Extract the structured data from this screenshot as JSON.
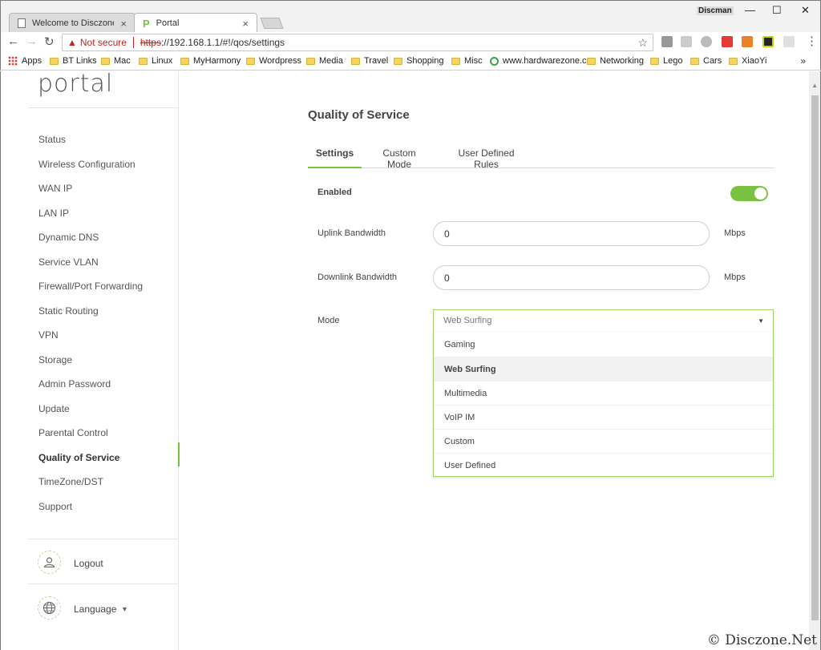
{
  "browser": {
    "profile_name": "Discman",
    "tabs": [
      {
        "label": "Welcome to Disczone! -",
        "close": "×"
      },
      {
        "label": "Portal",
        "close": "×"
      }
    ],
    "security_label": "Not secure",
    "url_protocol": "https",
    "url_rest": "://192.168.1.1/#!/qos/settings",
    "bookmarks": [
      "Apps",
      "BT Links",
      "Mac",
      "Linux",
      "MyHarmony",
      "Wordpress",
      "Media",
      "Travel",
      "Shopping",
      "Misc",
      "www.hardwarezone.c",
      "Networking",
      "Lego",
      "Cars",
      "XiaoYi"
    ],
    "more": "»"
  },
  "sidebar": {
    "logo": "portal",
    "items": [
      "Status",
      "Wireless Configuration",
      "WAN IP",
      "LAN IP",
      "Dynamic DNS",
      "Service VLAN",
      "Firewall/Port Forwarding",
      "Static Routing",
      "VPN",
      "Storage",
      "Admin Password",
      "Update",
      "Parental Control",
      "Quality of Service",
      "TimeZone/DST",
      "Support"
    ],
    "active_item": "Quality of Service",
    "logout": "Logout",
    "language": "Language"
  },
  "main": {
    "title": "Quality of Service",
    "tabs": [
      "Settings",
      "Custom Mode",
      "User Defined Rules"
    ],
    "active_tab": "Settings",
    "enabled_label": "Enabled",
    "enabled": true,
    "uplink_label": "Uplink Bandwidth",
    "uplink_value": "0",
    "downlink_label": "Downlink Bandwidth",
    "downlink_value": "0",
    "unit": "Mbps",
    "mode_label": "Mode",
    "mode_value": "Web Surfing",
    "mode_options": [
      "Gaming",
      "Web Surfing",
      "Multimedia",
      "VoIP IM",
      "Custom",
      "User Defined"
    ]
  },
  "colors": {
    "accent": "#7cc242",
    "warning": "#c5221f"
  },
  "watermark": "© Disczone.Net"
}
